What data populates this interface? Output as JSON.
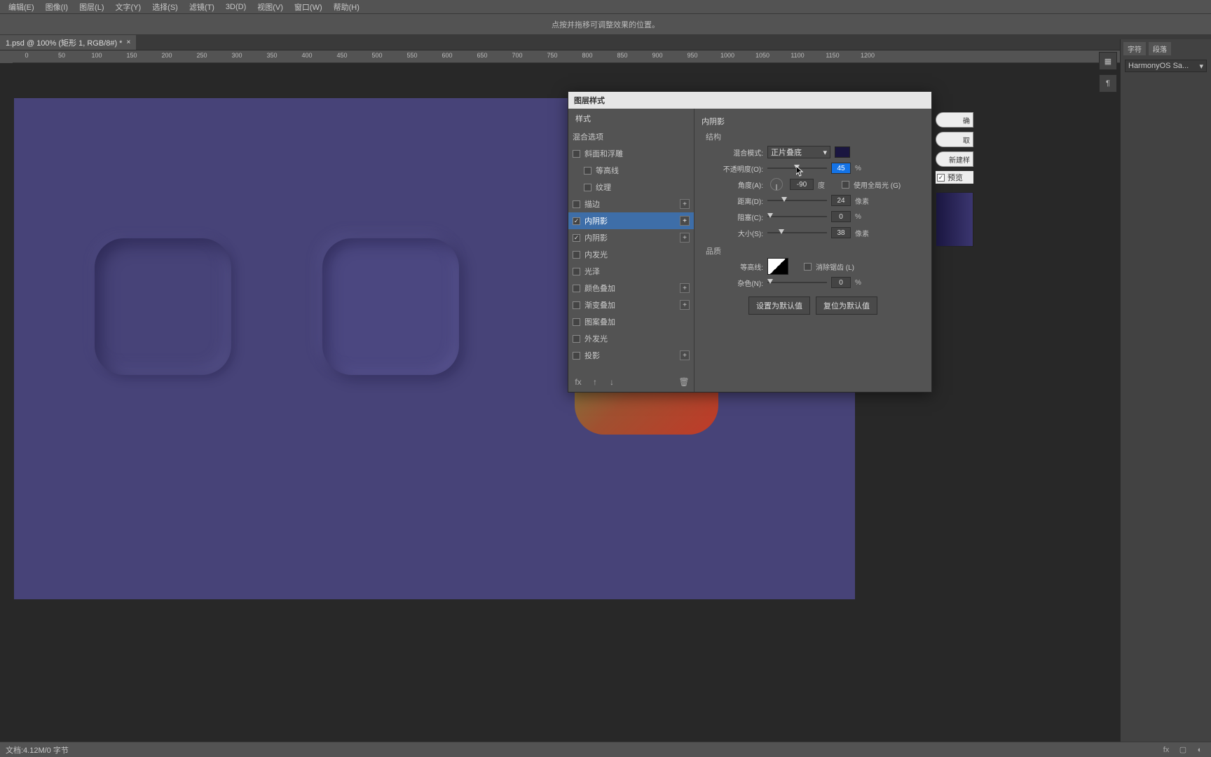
{
  "menubar": [
    "编辑(E)",
    "图像(I)",
    "图层(L)",
    "文字(Y)",
    "选择(S)",
    "滤镜(T)",
    "3D(D)",
    "视图(V)",
    "窗口(W)",
    "帮助(H)"
  ],
  "optionsbar_tip": "点按并拖移可调整效果的位置。",
  "tab": {
    "label": "1.psd @ 100% (矩形 1, RGB/8#) *",
    "close": "×"
  },
  "ruler_ticks": [
    0,
    50,
    100,
    150,
    200,
    250,
    300,
    350,
    400,
    450,
    500,
    550,
    600,
    650,
    700,
    750,
    800,
    850,
    900,
    950,
    1000,
    1050,
    1100,
    1150,
    1200
  ],
  "dialog": {
    "title": "图层样式",
    "left_header": "样式",
    "blend_options": "混合选项",
    "effects": [
      {
        "label": "斜面和浮雕",
        "checked": false,
        "plus": false
      },
      {
        "label": "等高线",
        "checked": false,
        "plus": false,
        "indent": true
      },
      {
        "label": "纹理",
        "checked": false,
        "plus": false,
        "indent": true
      },
      {
        "label": "描边",
        "checked": false,
        "plus": true
      },
      {
        "label": "内阴影",
        "checked": true,
        "plus": true,
        "active": true
      },
      {
        "label": "内阴影",
        "checked": true,
        "plus": true
      },
      {
        "label": "内发光",
        "checked": false,
        "plus": false
      },
      {
        "label": "光泽",
        "checked": false,
        "plus": false
      },
      {
        "label": "颜色叠加",
        "checked": false,
        "plus": true
      },
      {
        "label": "渐变叠加",
        "checked": false,
        "plus": true
      },
      {
        "label": "图案叠加",
        "checked": false,
        "plus": false
      },
      {
        "label": "外发光",
        "checked": false,
        "plus": false
      },
      {
        "label": "投影",
        "checked": false,
        "plus": true
      }
    ],
    "section_title": "内阴影",
    "structure": "结构",
    "blend_mode_label": "混合模式:",
    "blend_mode_value": "正片叠底",
    "opacity_label": "不透明度(O):",
    "opacity_value": "45",
    "pct": "%",
    "angle_label": "角度(A):",
    "angle_value": "-90",
    "degree": "度",
    "global_light_label": "使用全局光 (G)",
    "distance_label": "距离(D):",
    "distance_value": "24",
    "px": "像素",
    "choke_label": "阻塞(C):",
    "choke_value": "0",
    "size_label": "大小(S):",
    "size_value": "38",
    "quality": "品质",
    "contour_label": "等高线:",
    "antialias_label": "消除锯齿 (L)",
    "noise_label": "杂色(N):",
    "noise_value": "0",
    "make_default": "设置为默认值",
    "reset_default": "复位为默认值"
  },
  "sidebtns": {
    "ok": "确",
    "cancel": "取",
    "new_style": "新建样",
    "preview": "预览"
  },
  "rightdock": {
    "tab1": "字符",
    "tab2": "段落",
    "font": "HarmonyOS Sa..."
  },
  "statusbar": {
    "left": "文档:4.12M/0 字节"
  }
}
